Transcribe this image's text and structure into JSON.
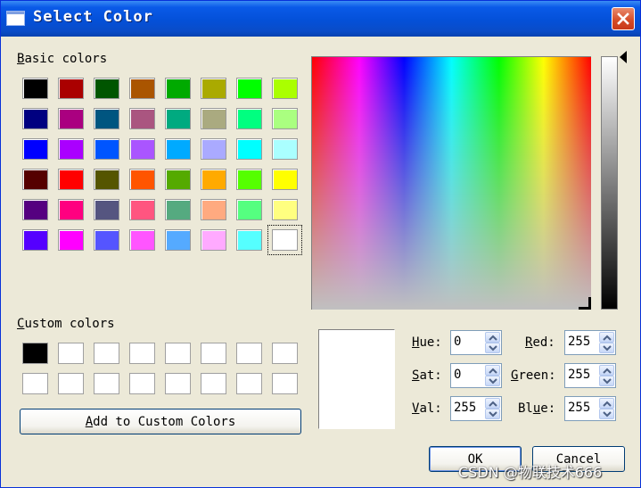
{
  "window": {
    "title": "Select Color"
  },
  "basic_colors": {
    "label_key": "B",
    "label_rest": "asic colors",
    "swatches": [
      "#000000",
      "#aa0000",
      "#005500",
      "#aa5500",
      "#00aa00",
      "#aaaa00",
      "#00ff00",
      "#aaff00",
      "#000080",
      "#aa0080",
      "#005580",
      "#aa5580",
      "#00aa80",
      "#aaaa80",
      "#00ff80",
      "#aaff80",
      "#0000ff",
      "#aa00ff",
      "#0055ff",
      "#aa55ff",
      "#00aaff",
      "#aaaaff",
      "#00ffff",
      "#aaffff",
      "#550000",
      "#ff0000",
      "#555500",
      "#ff5500",
      "#55aa00",
      "#ffaa00",
      "#55ff00",
      "#ffff00",
      "#550080",
      "#ff0080",
      "#555580",
      "#ff5580",
      "#55aa80",
      "#ffaa80",
      "#55ff80",
      "#ffff80",
      "#5500ff",
      "#ff00ff",
      "#5555ff",
      "#ff55ff",
      "#55aaff",
      "#ffaaff",
      "#55ffff",
      "#ffffff"
    ],
    "selected_index": 47
  },
  "custom_colors": {
    "label_key": "C",
    "label_rest": "ustom colors",
    "swatches": [
      "#000000",
      "#ffffff",
      "#ffffff",
      "#ffffff",
      "#ffffff",
      "#ffffff",
      "#ffffff",
      "#ffffff",
      "#ffffff",
      "#ffffff",
      "#ffffff",
      "#ffffff",
      "#ffffff",
      "#ffffff",
      "#ffffff",
      "#ffffff"
    ]
  },
  "add_custom_button": {
    "key": "A",
    "rest": "dd to Custom Colors"
  },
  "fields": {
    "hue": {
      "key": "H",
      "rest": "ue:",
      "value": "0"
    },
    "sat": {
      "key": "S",
      "rest": "at:",
      "value": "0"
    },
    "val": {
      "key": "V",
      "rest": "al:",
      "value": "255"
    },
    "red": {
      "key": "R",
      "rest": "ed:",
      "value": "255"
    },
    "green": {
      "key": "G",
      "rest": "reen:",
      "value": "255"
    },
    "blue": {
      "pre": "Bl",
      "key": "u",
      "rest": "e:",
      "value": "255"
    }
  },
  "buttons": {
    "ok": "OK",
    "cancel": "Cancel"
  },
  "current_color": "#ffffff",
  "watermark": "CSDN @物联技术666"
}
